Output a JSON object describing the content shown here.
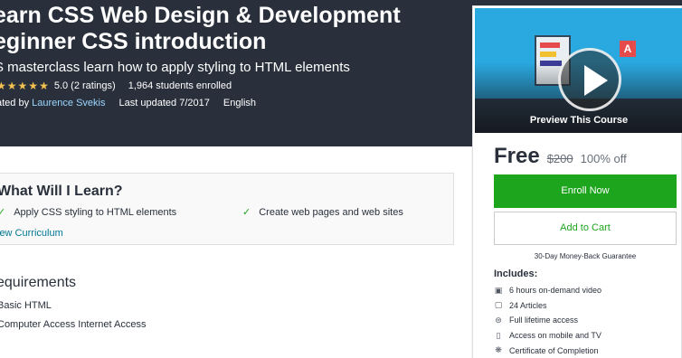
{
  "course": {
    "title_line1": "earn CSS Web Design & Development",
    "title_line2": "eginner CSS introduction",
    "subtitle": "S masterclass learn how to apply styling to HTML elements",
    "rating": "5.0 (2 ratings)",
    "students": "1,964 students enrolled",
    "created_prefix": "ated by",
    "author": "Laurence Svekis",
    "last_updated": "Last updated 7/2017",
    "language": "English",
    "stars": 5
  },
  "learn": {
    "title": "What Will I Learn?",
    "items": [
      "Apply CSS styling to HTML elements",
      "Create web pages and web sites"
    ],
    "view_curriculum": "iew Curriculum"
  },
  "requirements": {
    "title": "equirements",
    "items": [
      "Basic HTML",
      "Computer Access Internet Access"
    ]
  },
  "sidebar": {
    "preview_label": "Preview This Course",
    "price": "Free",
    "original_price": "$200",
    "discount": "100% off",
    "enroll_label": "Enroll Now",
    "cart_label": "Add to Cart",
    "guarantee": "30-Day Money-Back Guarantee",
    "includes_title": "Includes:",
    "includes": [
      {
        "icon": "video-icon",
        "text": "6 hours on-demand video"
      },
      {
        "icon": "article-icon",
        "text": "24 Articles"
      },
      {
        "icon": "infinity-icon",
        "text": "Full lifetime access"
      },
      {
        "icon": "mobile-icon",
        "text": "Access on mobile and TV"
      },
      {
        "icon": "certificate-icon",
        "text": "Certificate of Completion"
      }
    ]
  },
  "colors": {
    "hero_bg": "#29303b",
    "accent_green": "#1ea51e",
    "link_blue": "#007791",
    "star_gold": "#f4c150"
  }
}
